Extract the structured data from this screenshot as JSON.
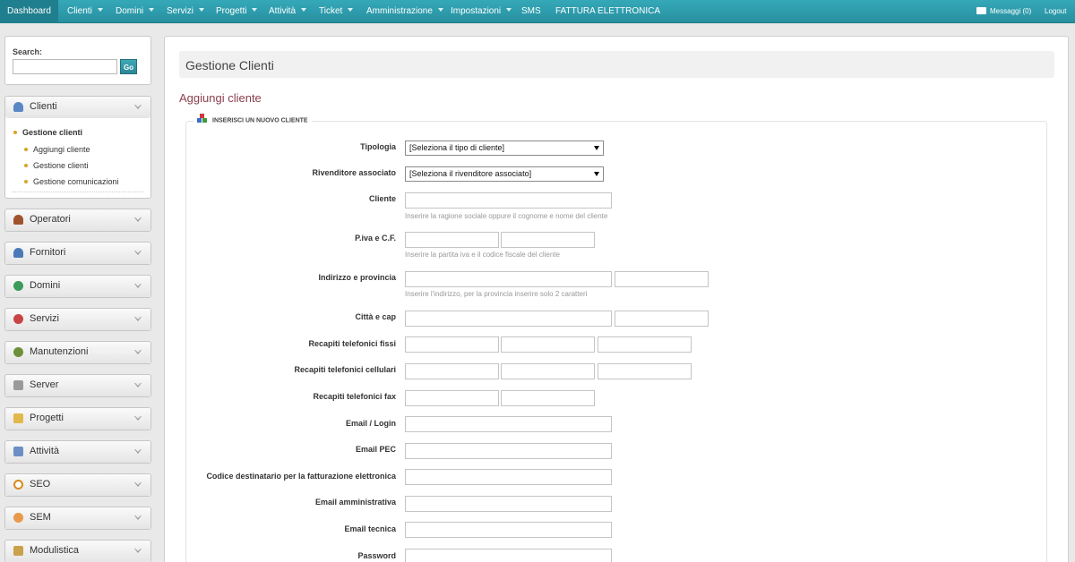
{
  "topnav": {
    "items": [
      {
        "label": "Dashboard",
        "dropdown": false,
        "active": true
      },
      {
        "label": "Clienti",
        "dropdown": true
      },
      {
        "label": "Domini",
        "dropdown": true
      },
      {
        "label": "Servizi",
        "dropdown": true
      },
      {
        "label": "Progetti",
        "dropdown": true
      },
      {
        "label": "Attività",
        "dropdown": true
      },
      {
        "label": "Ticket",
        "dropdown": true
      },
      {
        "label": "Amministrazione",
        "dropdown": true
      },
      {
        "label": "Impostazioni",
        "dropdown": true
      },
      {
        "label": "SMS",
        "dropdown": false
      },
      {
        "label": "FATTURA ELETTRONICA",
        "dropdown": false
      }
    ],
    "messages": "Messaggi (0)",
    "logout": "Logout"
  },
  "sidebar": {
    "search_label": "Search:",
    "search_value": "",
    "go_label": "Go",
    "clienti": {
      "label": "Clienti",
      "icon": "user-icon",
      "subitems": [
        "Gestione clienti",
        "Aggiungi cliente",
        "Gestione clienti",
        "Gestione comunicazioni"
      ]
    },
    "sections": [
      {
        "label": "Operatori",
        "icon": "operator-icon"
      },
      {
        "label": "Fornitori",
        "icon": "supplier-icon"
      },
      {
        "label": "Domini",
        "icon": "globe-icon"
      },
      {
        "label": "Servizi",
        "icon": "services-icon"
      },
      {
        "label": "Manutenzioni",
        "icon": "maintenance-icon"
      },
      {
        "label": "Server",
        "icon": "server-icon"
      },
      {
        "label": "Progetti",
        "icon": "projects-icon"
      },
      {
        "label": "Attività",
        "icon": "activity-icon"
      },
      {
        "label": "SEO",
        "icon": "magnifier-icon"
      },
      {
        "label": "SEM",
        "icon": "sem-icon"
      },
      {
        "label": "Modulistica",
        "icon": "forms-icon"
      }
    ]
  },
  "main": {
    "page_title": "Gestione Clienti",
    "subtitle": "Aggiungi cliente",
    "legend": "INSERISCI UN NUOVO CLIENTE",
    "form": {
      "tipologia": {
        "label": "Tipologia",
        "value": "[Seleziona il tipo di cliente]"
      },
      "rivenditore": {
        "label": "Rivenditore associato",
        "value": "[Seleziona il rivenditore associato]"
      },
      "cliente": {
        "label": "Cliente",
        "hint": "Inserire la ragione sociale oppure il cognome e nome del cliente"
      },
      "piva": {
        "label": "P.iva e C.F.",
        "hint": "Inserire la partita iva e il codice fiscale del cliente"
      },
      "indirizzo": {
        "label": "Indirizzo e provincia",
        "hint": "Inserire l'indirizzo, per la provincia inserire solo 2 caratteri"
      },
      "citta": {
        "label": "Città e cap"
      },
      "tel_fissi": {
        "label": "Recapiti telefonici fissi"
      },
      "tel_cell": {
        "label": "Recapiti telefonici cellulari"
      },
      "tel_fax": {
        "label": "Recapiti telefonici fax"
      },
      "email_login": {
        "label": "Email / Login"
      },
      "email_pec": {
        "label": "Email PEC"
      },
      "codice_dest": {
        "label": "Codice destinatario per la fatturazione elettronica"
      },
      "email_amm": {
        "label": "Email amministrativa"
      },
      "email_tec": {
        "label": "Email tecnica"
      },
      "password": {
        "label": "Password"
      }
    }
  },
  "colors": {
    "nav": "#2f9fb0",
    "subtitle": "#8a3e4d",
    "accent_dot": "#d7a42b"
  }
}
